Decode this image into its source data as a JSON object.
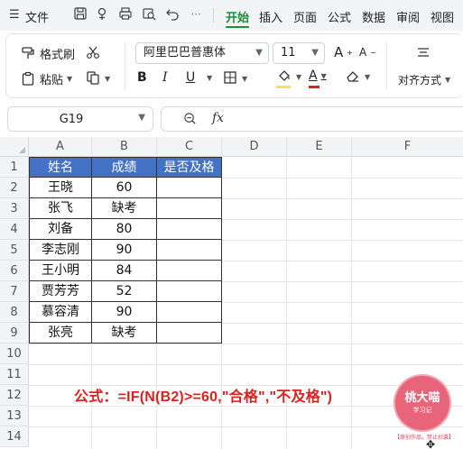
{
  "menu": {
    "hamburger": "☰",
    "file": "文件",
    "tabs": [
      "开始",
      "插入",
      "页面",
      "公式",
      "数据",
      "审阅",
      "视图"
    ]
  },
  "ribbon": {
    "format_painter": "格式刷",
    "paste": "粘贴",
    "font_name": "阿里巴巴普惠体",
    "font_size": "11",
    "bold": "B",
    "italic": "I",
    "underline": "U",
    "align": "对齐方式",
    "grow_font": "A",
    "shrink_font": "A",
    "underline_color": "#c00000",
    "fill_color": "#ffd966",
    "font_color": "#e02020"
  },
  "namebox": {
    "value": "G19"
  },
  "formula_bar": {
    "fx": "fx",
    "value": ""
  },
  "columns": [
    "A",
    "B",
    "C",
    "D",
    "E",
    "F"
  ],
  "rows": [
    "1",
    "2",
    "3",
    "4",
    "5",
    "6",
    "7",
    "8",
    "9",
    "10",
    "11",
    "12",
    "13",
    "14"
  ],
  "table": {
    "headers": [
      "姓名",
      "成绩",
      "是否及格"
    ],
    "rows": [
      [
        "王晓",
        "60",
        ""
      ],
      [
        "张飞",
        "缺考",
        ""
      ],
      [
        "刘备",
        "80",
        ""
      ],
      [
        "李志刚",
        "90",
        ""
      ],
      [
        "王小明",
        "84",
        ""
      ],
      [
        "贾芳芳",
        "52",
        ""
      ],
      [
        "慕容清",
        "90",
        ""
      ],
      [
        "张亮",
        "缺考",
        ""
      ]
    ]
  },
  "note": "公式：=IF(N(B2)>=60,\"合格\",\"不及格\")",
  "watermark": {
    "name": "桃大喵",
    "sub": "学习记",
    "tag": "【原创作品，禁止抄袭】"
  },
  "colors": {
    "accent": "#1a8f3c",
    "header_fill": "#4472c4",
    "note_red": "#e02020"
  }
}
